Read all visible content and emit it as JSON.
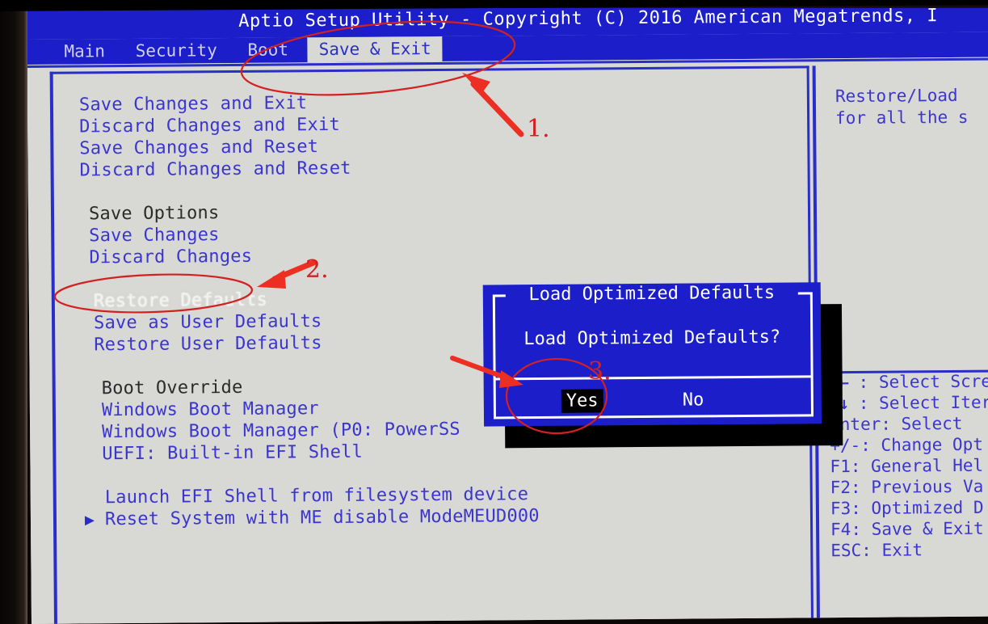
{
  "window": {
    "title": "Aptio Setup Utility - Copyright (C) 2016 American Megatrends, I"
  },
  "menu": {
    "tabs": [
      {
        "label": "Main",
        "active": false
      },
      {
        "label": "Security",
        "active": false
      },
      {
        "label": "Boot",
        "active": false
      },
      {
        "label": "Save & Exit",
        "active": true
      }
    ]
  },
  "left_panel": {
    "items": [
      {
        "label": "Save Changes and Exit",
        "kind": "option"
      },
      {
        "label": "Discard Changes and Exit",
        "kind": "option"
      },
      {
        "label": "Save Changes and Reset",
        "kind": "option"
      },
      {
        "label": "Discard Changes and Reset",
        "kind": "option"
      },
      {
        "label": "Save Options",
        "kind": "header"
      },
      {
        "label": "Save Changes",
        "kind": "option"
      },
      {
        "label": "Discard Changes",
        "kind": "option"
      },
      {
        "label": "Restore Defaults",
        "kind": "selected"
      },
      {
        "label": "Save as User Defaults",
        "kind": "option"
      },
      {
        "label": "Restore User Defaults",
        "kind": "option"
      },
      {
        "label": "Boot Override",
        "kind": "header"
      },
      {
        "label": "Windows Boot Manager",
        "kind": "option"
      },
      {
        "label": "Windows Boot Manager (P0: PowerSS",
        "kind": "option"
      },
      {
        "label": "UEFI: Built-in EFI Shell",
        "kind": "option"
      },
      {
        "label": "Launch EFI Shell from filesystem device",
        "kind": "option"
      },
      {
        "label": "Reset System with ME disable ModeMEUD000",
        "kind": "submenu"
      }
    ]
  },
  "right_panel": {
    "help": [
      "Restore/Load",
      "for all the s"
    ],
    "keys": [
      {
        "key": "→←:",
        "desc": "Select Scre"
      },
      {
        "key": "↑↓:",
        "desc": "Select Iter"
      },
      {
        "key": "Enter:",
        "desc": "Select"
      },
      {
        "key": "+/-:",
        "desc": "Change Opt"
      },
      {
        "key": "F1:",
        "desc": "General Hel"
      },
      {
        "key": "F2:",
        "desc": "Previous Va"
      },
      {
        "key": "F3:",
        "desc": "Optimized D"
      },
      {
        "key": "F4:",
        "desc": "Save & Exit"
      },
      {
        "key": "ESC:",
        "desc": "Exit"
      }
    ]
  },
  "dialog": {
    "title": "Load Optimized Defaults",
    "message": "Load Optimized Defaults?",
    "buttons": [
      {
        "label": "Yes",
        "selected": true
      },
      {
        "label": "No",
        "selected": false
      }
    ]
  },
  "annotations": {
    "markers": [
      {
        "id": "1",
        "label": "1.",
        "target": "save-and-exit-tab"
      },
      {
        "id": "2",
        "label": "2.",
        "target": "restore-defaults-item"
      },
      {
        "id": "3",
        "label": "3.",
        "target": "dialog-yes-button"
      }
    ],
    "color": "#d32020"
  },
  "colors": {
    "screen_bg": "#d8d8d4",
    "bios_blue": "#1b1ec9",
    "text_blue": "#3b35cf",
    "header_text": "#2b2b2b",
    "annotation_red": "#d32020",
    "dialog_bg": "#1b1ec9"
  }
}
